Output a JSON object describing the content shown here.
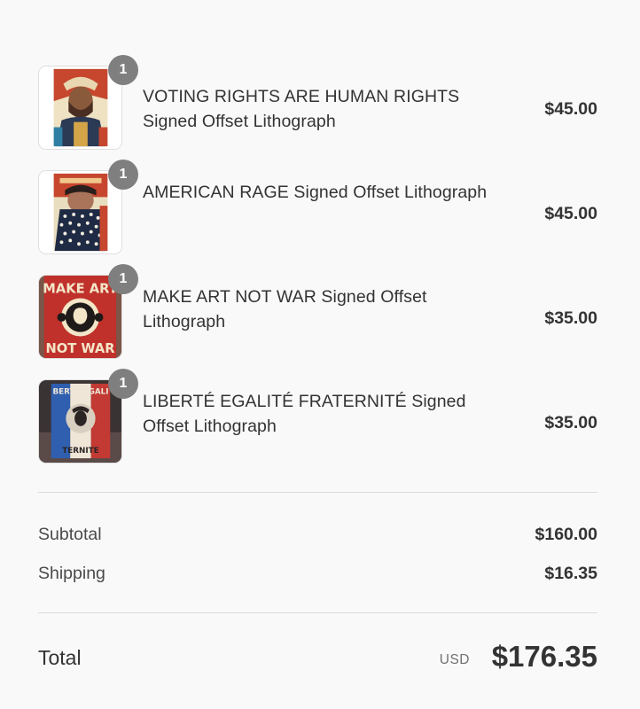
{
  "line_items": [
    {
      "quantity": "1",
      "title": "VOTING RIGHTS ARE HUMAN RIGHTS Signed Offset Lithograph",
      "price": "$45.00",
      "thumbnail_icon": "voting-rights-poster-thumbnail"
    },
    {
      "quantity": "1",
      "title": "AMERICAN RAGE Signed Offset Lithograph",
      "price": "$45.00",
      "thumbnail_icon": "american-rage-poster-thumbnail"
    },
    {
      "quantity": "1",
      "title": "MAKE ART NOT WAR Signed Offset Lithograph",
      "price": "$35.00",
      "thumbnail_icon": "make-art-not-war-poster-thumbnail",
      "thumbnail_text_top": "MAKE ART",
      "thumbnail_text_bottom": "NOT WAR"
    },
    {
      "quantity": "1",
      "title": "LIBERTÉ EGALITÉ FRATERNITÉ Signed Offset Lithograph",
      "price": "$35.00",
      "thumbnail_icon": "liberte-egalite-fraternite-poster-thumbnail",
      "thumbnail_text_top": "BERTE EGALI",
      "thumbnail_text_bottom": "TERNITE"
    }
  ],
  "subtotal": {
    "label": "Subtotal",
    "value": "$160.00"
  },
  "shipping": {
    "label": "Shipping",
    "value": "$16.35"
  },
  "total": {
    "label": "Total",
    "currency": "USD",
    "value": "$176.35"
  },
  "colors": {
    "background": "#f9f9f9",
    "badge": "#7f7f7f",
    "text": "#333333",
    "muted_text": "#717171",
    "divider": "#dcdcdc"
  }
}
